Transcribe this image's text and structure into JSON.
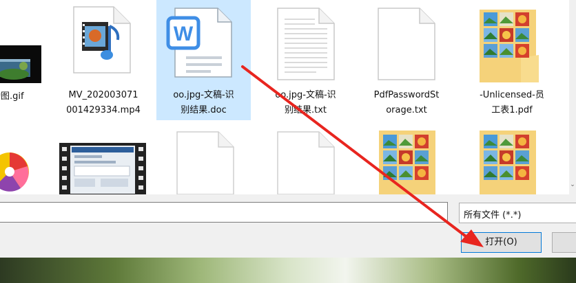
{
  "files": [
    {
      "name": "动图.gif",
      "kind": "gif"
    },
    {
      "name": "MV_202003071001429334.mp4",
      "line1": "MV_202003071",
      "line2": "001429334.mp4",
      "kind": "video"
    },
    {
      "name": "oo.jpg-文稿-识别结果.doc",
      "line1": "oo.jpg-文稿-识",
      "line2": "别结果.doc",
      "kind": "word",
      "selected": true
    },
    {
      "name": "oo.jpg-文稿-识别结果.txt",
      "line1": "oo.jpg-文稿-识",
      "line2": "别结果.txt",
      "kind": "text"
    },
    {
      "name": "PdfPasswordStorage.txt",
      "line1": "PdfPasswordSt",
      "line2": "orage.txt",
      "kind": "blank"
    },
    {
      "name": "-Unlicensed-员工表1.pdf",
      "line1": "-Unlicensed-员",
      "line2": "工表1.pdf",
      "kind": "folder-photos"
    }
  ],
  "file_type_filter": {
    "value": "所有文件 (*.*)"
  },
  "open_button": {
    "label": "打开(O)"
  },
  "annotation_color": "#e8251f"
}
